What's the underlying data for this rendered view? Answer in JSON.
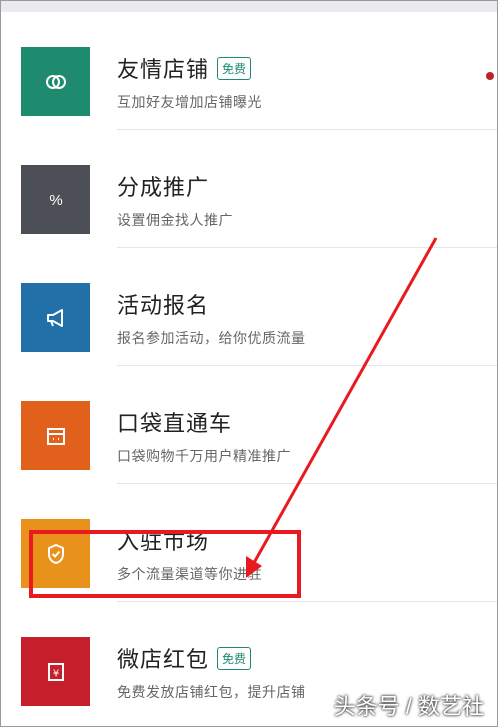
{
  "items": [
    {
      "title": "友情店铺",
      "badge": "免费",
      "subtitle": "互加好友增加店铺曝光",
      "icon": "link-rings-icon",
      "color": "#1e8a6e",
      "dot": true
    },
    {
      "title": "分成推广",
      "badge": "",
      "subtitle": "设置佣金找人推广",
      "icon": "percent-icon",
      "color": "#4c4f55",
      "dot": false
    },
    {
      "title": "活动报名",
      "badge": "",
      "subtitle": "报名参加活动，给你优质流量",
      "icon": "megaphone-icon",
      "color": "#2170a8",
      "dot": false
    },
    {
      "title": "口袋直通车",
      "badge": "",
      "subtitle": "口袋购物千万用户精准推广",
      "icon": "storefront-icon",
      "color": "#e0601c",
      "dot": false
    },
    {
      "title": "入驻市场",
      "badge": "",
      "subtitle": "多个流量渠道等你进驻",
      "icon": "shield-check-icon",
      "color": "#e8921c",
      "dot": false
    },
    {
      "title": "微店红包",
      "badge": "免费",
      "subtitle": "免费发放店铺红包，提升店铺",
      "icon": "red-envelope-icon",
      "color": "#c41f2b",
      "dot": false
    }
  ],
  "watermark": "头条号 / 数艺社",
  "annotation_color": "#e8191f"
}
